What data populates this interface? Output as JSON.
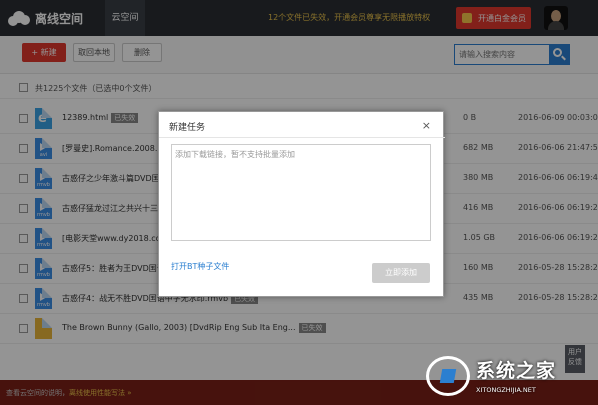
{
  "app": {
    "title": "离线空间",
    "nav_tab": "云空间",
    "promo": "12个文件已失效，开通会员尊享无限播放特权",
    "vip_button": "开通白金会员"
  },
  "toolbar": {
    "new_label": "+ 新建",
    "local_label": "取回本地",
    "delete_label": "删除",
    "search_placeholder": "请输入搜索内容"
  },
  "summary": "共1225个文件（已选中0个文件）",
  "files": [
    {
      "name": "12389.html",
      "badge": "已失效",
      "size": "0 B",
      "date": "2016-06-09 00:03:02",
      "icon": "html-icon",
      "ext": ""
    },
    {
      "name": "[罗曼史].Romance.2008.DV",
      "badge": "",
      "size": "682 MB",
      "date": "2016-06-06 21:47:50",
      "icon": "video-icon",
      "ext": "avi"
    },
    {
      "name": "古惑仔之少年激斗篇DVD国",
      "badge": "",
      "size": "380 MB",
      "date": "2016-06-06 06:19:42",
      "icon": "video-icon",
      "ext": "rmvb"
    },
    {
      "name": "古惑仔猛龙过江之共兴十三妹",
      "badge": "",
      "size": "416 MB",
      "date": "2016-06-06 06:19:23",
      "icon": "video-icon",
      "ext": "rmvb"
    },
    {
      "name": "[电影天堂www.dy2018.co",
      "badge": "",
      "size": "1.05 GB",
      "date": "2016-06-06 06:19:23",
      "icon": "video-icon",
      "ext": "rmvb"
    },
    {
      "name": "古惑仔5：胜者为王DVD国语中字无水印CD2.rmvb",
      "badge": "已失效",
      "size": "160 MB",
      "date": "2016-05-28 15:28:22",
      "icon": "video-icon",
      "ext": "rmvb"
    },
    {
      "name": "古惑仔4：战无不胜DVD国语中字无水印.rmvb",
      "badge": "已失效",
      "size": "435 MB",
      "date": "2016-05-28 15:28:22",
      "icon": "video-icon",
      "ext": "rmvb"
    },
    {
      "name": "The Brown Bunny (Gallo, 2003) [DvdRip Eng Sub Ita Eng...",
      "badge": "已失效",
      "size": "",
      "date": "",
      "icon": "folder-icon",
      "ext": ""
    }
  ],
  "modal": {
    "title": "新建任务",
    "close": "×",
    "placeholder": "添加下载链接，暂不支持批量添加",
    "bt_link": "打开BT种子文件",
    "submit": "立即添加"
  },
  "bottom": {
    "text": "查看云空间的说明，",
    "link": "离线使用性能写法 »"
  },
  "side_tab": "用户反馈",
  "watermark": {
    "title": "系统之家",
    "subtitle": "XITONGZHIJIA.NET"
  }
}
